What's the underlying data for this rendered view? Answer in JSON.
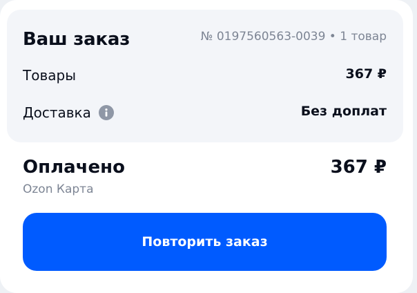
{
  "order": {
    "title": "Ваш заказ",
    "meta": "№ 0197560563-0039 • 1 товар",
    "rows": [
      {
        "label": "Товары",
        "value": "367 ₽"
      },
      {
        "label": "Доставка",
        "value": "Без доплат",
        "icon": "info-icon"
      }
    ]
  },
  "payment": {
    "status": "Оплачено",
    "amount": "367 ₽",
    "method": "Ozon Карта"
  },
  "actions": {
    "repeat_label": "Повторить заказ"
  },
  "colors": {
    "accent": "#005bff",
    "panel": "#f3f5f9",
    "muted_text": "#7d8594",
    "icon": "#8f97a6"
  }
}
